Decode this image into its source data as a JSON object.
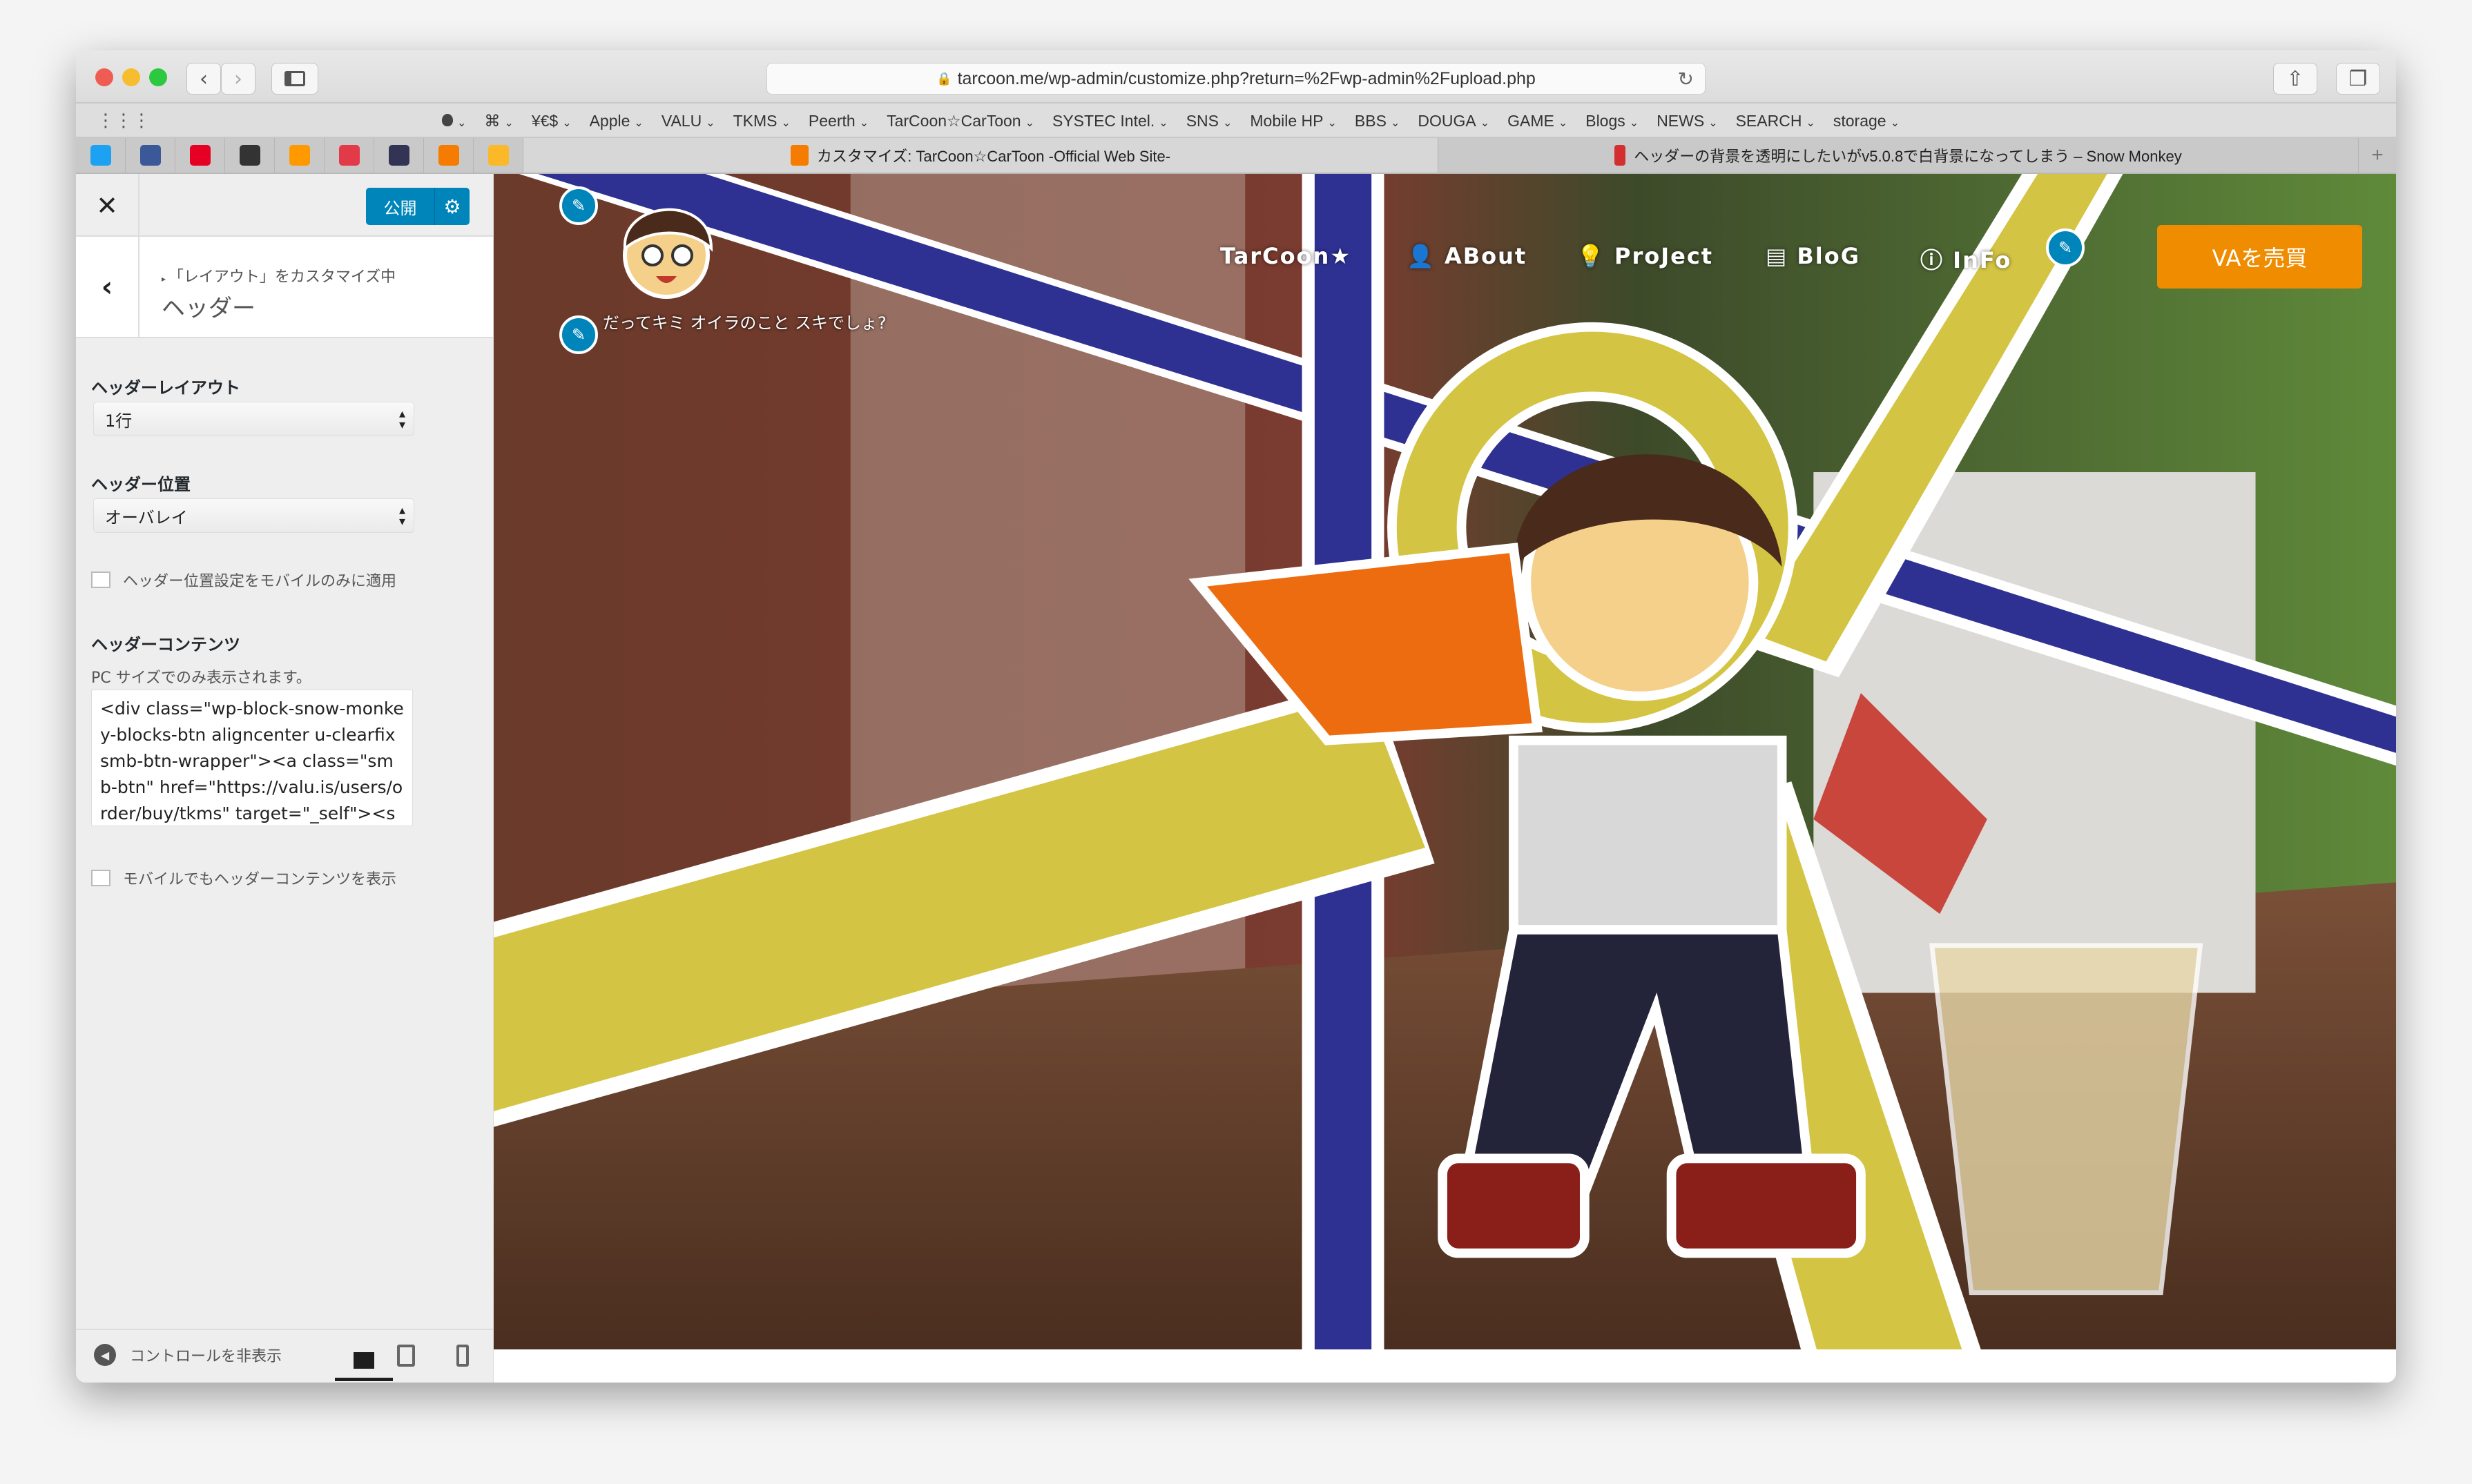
{
  "browser": {
    "url": "tarcoon.me/wp-admin/customize.php?return=%2Fwp-admin%2Fupload.php",
    "bookmarks": [
      "",
      "⌘",
      "¥€$",
      "Apple",
      "VALU",
      "TKMS",
      "Peerth",
      "TarCoon☆CarToon",
      "SYSTEC Intel.",
      "SNS",
      "Mobile HP",
      "BBS",
      "DOUGA",
      "GAME",
      "Blogs",
      "NEWS",
      "SEARCH",
      "storage"
    ],
    "favicons": [
      {
        "icon": "twitter-icon",
        "color": "#1da1f2"
      },
      {
        "icon": "facebook-icon",
        "color": "#3b5998"
      },
      {
        "icon": "pinterest-icon",
        "color": "#e60023"
      },
      {
        "icon": "instagram-icon",
        "color": "#333333"
      },
      {
        "icon": "amazon-icon",
        "color": "#ff9900"
      },
      {
        "icon": "flower-icon",
        "color": "#e33a4a"
      },
      {
        "icon": "tree-icon",
        "color": "#333355"
      },
      {
        "icon": "shield-icon",
        "color": "#f57c00"
      },
      {
        "icon": "valu-icon",
        "color": "#fbb829"
      }
    ],
    "tabs": [
      {
        "title": "カスタマイズ: TarCoon☆CarToon -Official Web Site-",
        "active": true
      },
      {
        "title": "ヘッダーの背景を透明にしたいがv5.0.8で白背景になってしまう – Snow Monkey",
        "active": false
      }
    ]
  },
  "sidebar": {
    "publish_label": "公開",
    "breadcrumb": "「レイアウト」をカスタマイズ中",
    "section_title": "ヘッダー",
    "header_layout_label": "ヘッダーレイアウト",
    "header_layout_value": "1行",
    "header_position_label": "ヘッダー位置",
    "header_position_value": "オーバレイ",
    "mobile_only_label": "ヘッダー位置設定をモバイルのみに適用",
    "mobile_only_checked": false,
    "header_content_label": "ヘッダーコンテンツ",
    "header_content_hint": "PC サイズでのみ表示されます。",
    "header_content_value": "<div class=\"wp-block-snow-monkey-blocks-btn aligncenter u-clearfix smb-btn-wrapper\"><a class=\"smb-btn\" href=\"https://valu.is/users/order/buy/tkms\" target=\"_self\"><span class=\"smb-",
    "show_mobile_label": "モバイルでもヘッダーコンテンツを表示",
    "show_mobile_checked": false,
    "hide_controls_label": "コントロールを非表示",
    "active_device": "desktop"
  },
  "preview": {
    "tagline": "だってキミ オイラのこと スキでしょ?",
    "nav": [
      "TarCoon★",
      "ABout",
      "ProJect",
      "BloG",
      "InFo"
    ],
    "cta_label": "VAを売買",
    "colors": {
      "accent": "#f08c00",
      "wp_blue": "#0085ba",
      "stripe_blue": "#2e3192",
      "stripe_yellow": "#d4c443"
    }
  }
}
